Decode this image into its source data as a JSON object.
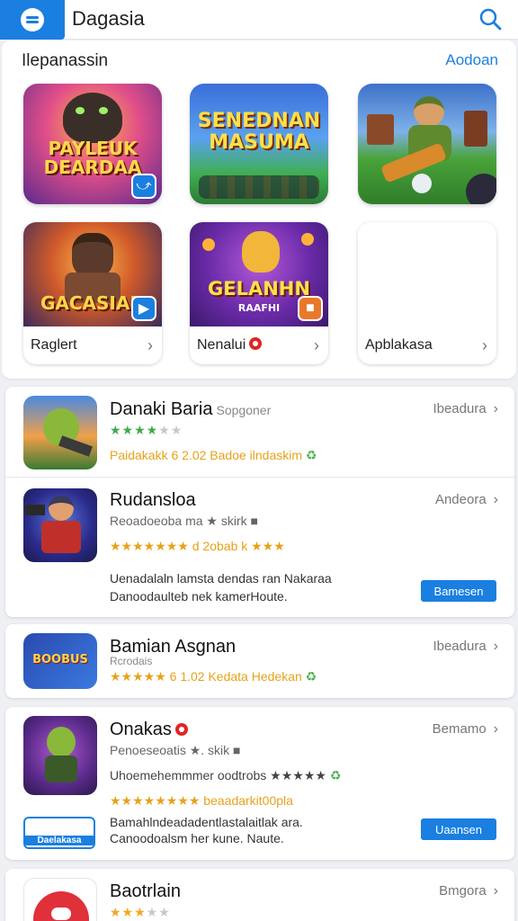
{
  "header": {
    "title": "Dagasia"
  },
  "featured": {
    "title": "Ilepanassin",
    "link": "Aodoan",
    "tiles": [
      {
        "art": "PAYLEUK DEARDAA"
      },
      {
        "art": "SENEDNAN MASUMA"
      },
      {
        "art": ""
      }
    ],
    "cards": [
      {
        "art": "GACASIAN",
        "caption": "Raglert"
      },
      {
        "art": "GELANHN",
        "art_sub": "RAAFHI",
        "caption": "Nenalui"
      },
      {
        "art": "",
        "caption": "Apblakasa"
      }
    ]
  },
  "list": [
    {
      "title": "Danaki Baria",
      "subtitle": "Sopgoner",
      "meta": "Ibeadura",
      "rating": 3,
      "line": "Paidakakk 6 2.02 Badoe ilndaskim"
    },
    {
      "title": "Rudansloa",
      "meta": "Andeora",
      "line1": "Reoadoeoba ma ★ skirk ■",
      "line2": "★★★★★★★ d 2obab k ★★★",
      "desc1": "Uenadalaln lamsta dendas ran Nakaraa",
      "desc2": "Danoodaulteb nek kamerHoute.",
      "action": "Bamesen"
    },
    {
      "title": "Bamian Asgnan",
      "meta": "Ibeadura",
      "line1": "Rcrodais",
      "line2": "★★★★★ 6 1.02 Kedata Hedekan",
      "art": "BOOBUS"
    },
    {
      "title": "Onakas",
      "meta": "Bemamo",
      "line1": "Penoeseoatis ★. skik ■",
      "line2": "Uhoemehemmmer oodtrobs ★★★★★",
      "line3": "★★★★★★★★ beaadarkit00pla",
      "desc1": "Bamahlndeadadentlastalaitlak ara.",
      "desc2": "Canoodoalsm her kune. Naute.",
      "action": "Uaansen",
      "badge": "Daelakasa"
    },
    {
      "title": "Baotrlain",
      "meta": "Bmgora",
      "rating": 3
    }
  ]
}
